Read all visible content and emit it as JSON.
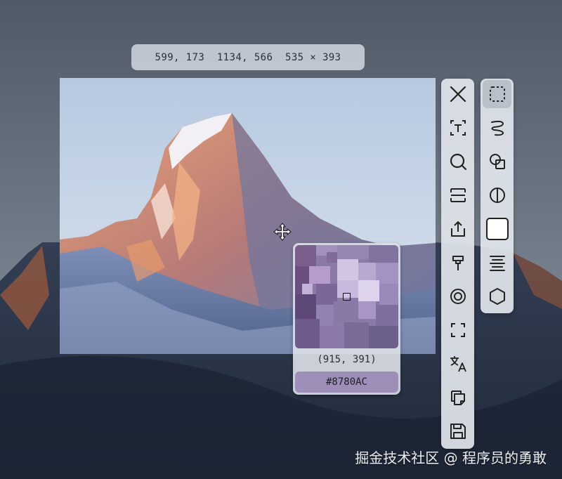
{
  "selection_info": {
    "start": "599, 173",
    "end": "1134, 566",
    "size": "535 × 393"
  },
  "magnifier": {
    "position": "(915, 391)",
    "color_hex": "#8780AC"
  },
  "main_toolbar": [
    {
      "name": "close-icon",
      "label": "Close"
    },
    {
      "name": "text-icon",
      "label": "Text"
    },
    {
      "name": "search-icon",
      "label": "OCR search"
    },
    {
      "name": "long-screenshot-icon",
      "label": "Scroll capture"
    },
    {
      "name": "share-icon",
      "label": "Share"
    },
    {
      "name": "pin-icon",
      "label": "Pin"
    },
    {
      "name": "target-icon",
      "label": "Target"
    },
    {
      "name": "frame-icon",
      "label": "Frame"
    },
    {
      "name": "translate-icon",
      "label": "Translate"
    },
    {
      "name": "copy-icon",
      "label": "Copy"
    },
    {
      "name": "save-icon",
      "label": "Save"
    }
  ],
  "side_toolbar": [
    {
      "name": "rect-select-icon",
      "label": "Rectangle select",
      "active": true
    },
    {
      "name": "freehand-icon",
      "label": "Freehand"
    },
    {
      "name": "shapes-icon",
      "label": "Shapes"
    },
    {
      "name": "contrast-icon",
      "label": "Invert"
    },
    {
      "name": "white-fill-icon",
      "label": "Fill"
    },
    {
      "name": "align-icon",
      "label": "Align"
    },
    {
      "name": "hexagon-icon",
      "label": "Polygon"
    }
  ],
  "watermark": "掘金技术社区 @ 程序员的勇敢",
  "colors": {
    "sky_top": "#5a6572",
    "sky_bottom": "#9aa4b0",
    "peak_light": "#f0a06c",
    "peak_shadow": "#5f6d91",
    "sample_swatch": "#8780AC"
  }
}
